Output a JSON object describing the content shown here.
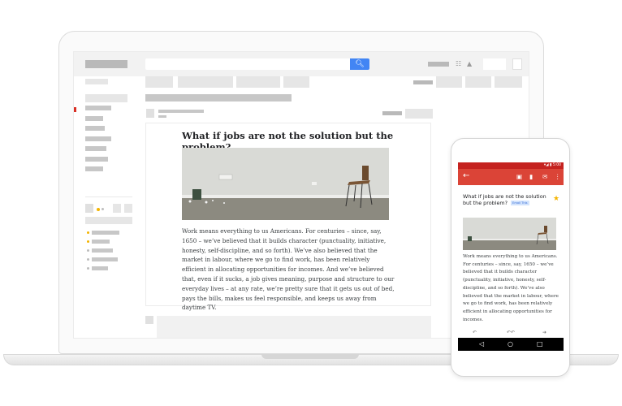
{
  "desktop": {
    "message": {
      "title": "What if jobs are not the solution but the problem?",
      "body": "Work means everything to us Americans. For centuries – since, say, 1650 – we’ve believed that it builds character (punctuality, initiative, honesty, self-discipline, and so forth). We’ve also believed that the market in labour, where we go to find work, has been relatively efficient in allocating opportunities for incomes. And we’ve believed that, even if it sucks, a job gives meaning, purpose and structure to our everyday lives – at any rate, we’re pretty sure that it gets us out of bed, pays the bills, makes us feel responsible, and keeps us away from daytime TV."
    },
    "icons": {
      "search": "search-icon",
      "apps": "apps-grid-icon",
      "notifications": "bell-icon",
      "account": "account-icon"
    },
    "colors": {
      "search_button": "#4285f4",
      "selected_folder": "#d93025",
      "label_dot_orange": "#f4b400",
      "label_dot_gray": "#bdbdbd"
    }
  },
  "phone": {
    "status_time": "5:00",
    "subject": "What if jobs are not the solution but the problem?",
    "label": "Email This",
    "body": "Work means everything to us Americans. For centuries – since, say, 1650 – we’ve believed that it builds character (punctuality, initiative, honesty, self-discipline, and so forth). We’ve also believed that the market in labour, where we go to find work, has been relatively efficient in allocating opportunities for incomes.",
    "colors": {
      "app_bar": "#db4437",
      "status_bar": "#c5221f",
      "star": "#f4b400"
    }
  }
}
